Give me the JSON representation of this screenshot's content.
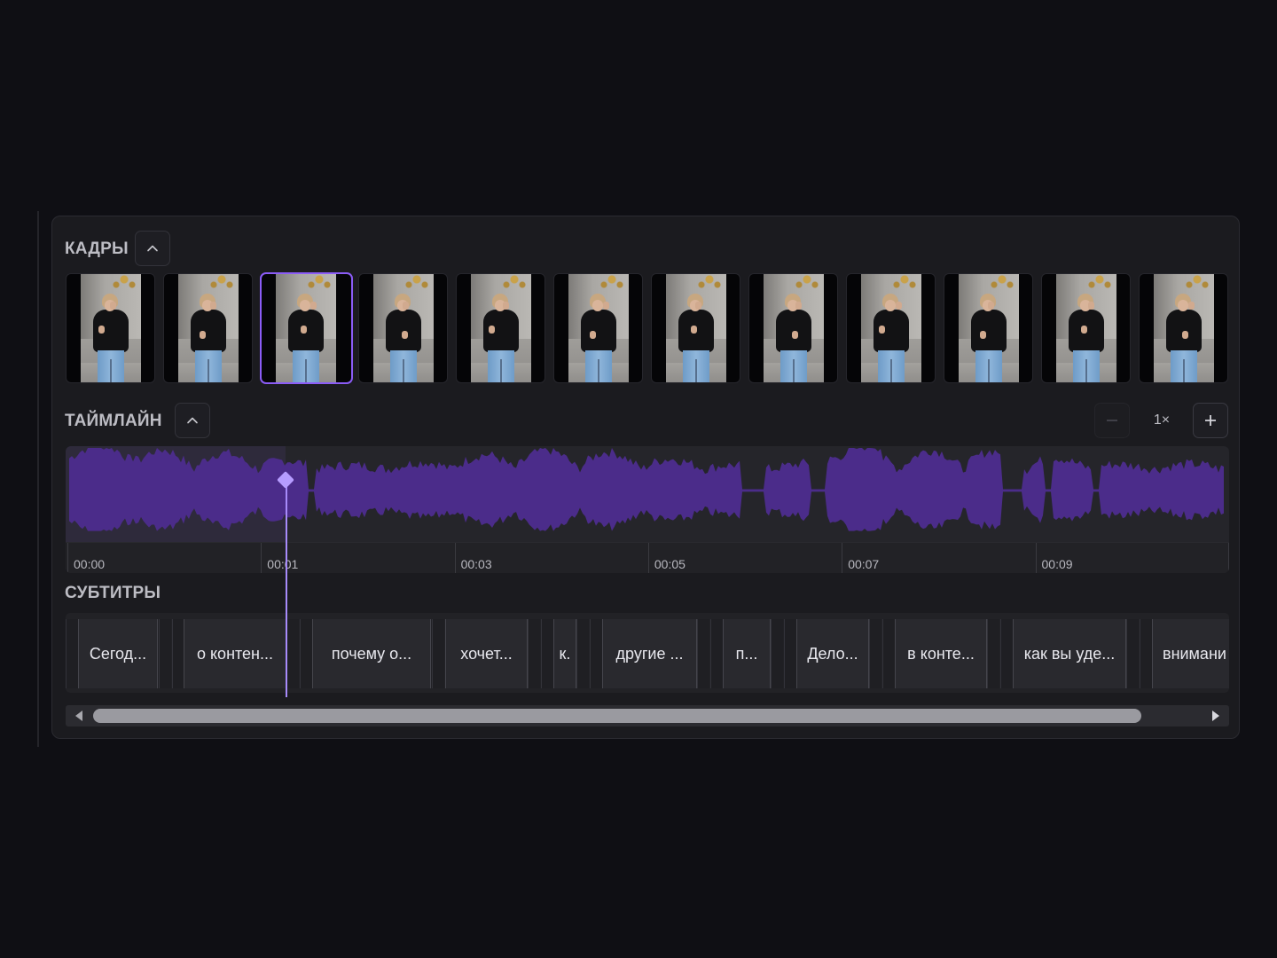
{
  "frames_section": {
    "title": "КАДРЫ",
    "collapse_icon": "chevron-up-icon",
    "frame_count": 12,
    "selected_index": 2
  },
  "timeline_section": {
    "title": "ТАЙМЛАЙН",
    "collapse_icon": "chevron-up-icon",
    "zoom_out_icon": "minus-icon",
    "zoom_in_icon": "plus-icon",
    "zoom_value": "1×",
    "time_labels": [
      "00:00",
      "00:01",
      "00:03",
      "00:05",
      "00:07",
      "00:09"
    ],
    "waveform_color": "#4b2c8a",
    "playhead_color": "#a78bfa"
  },
  "subtitles_section": {
    "title": "СУБТИТРЫ",
    "clips": [
      "Сегод...",
      "о контен...",
      "почему о...",
      "хочет...",
      "к.",
      "другие ...",
      "п...",
      "Дело...",
      "в конте...",
      "как вы уде...",
      "внимани"
    ]
  },
  "scrollbar": {
    "left_icon": "triangle-left-icon",
    "right_icon": "triangle-right-icon"
  },
  "colors": {
    "accent": "#8b5cf6",
    "background": "#0f0f14",
    "panel": "#1b1b1f"
  }
}
